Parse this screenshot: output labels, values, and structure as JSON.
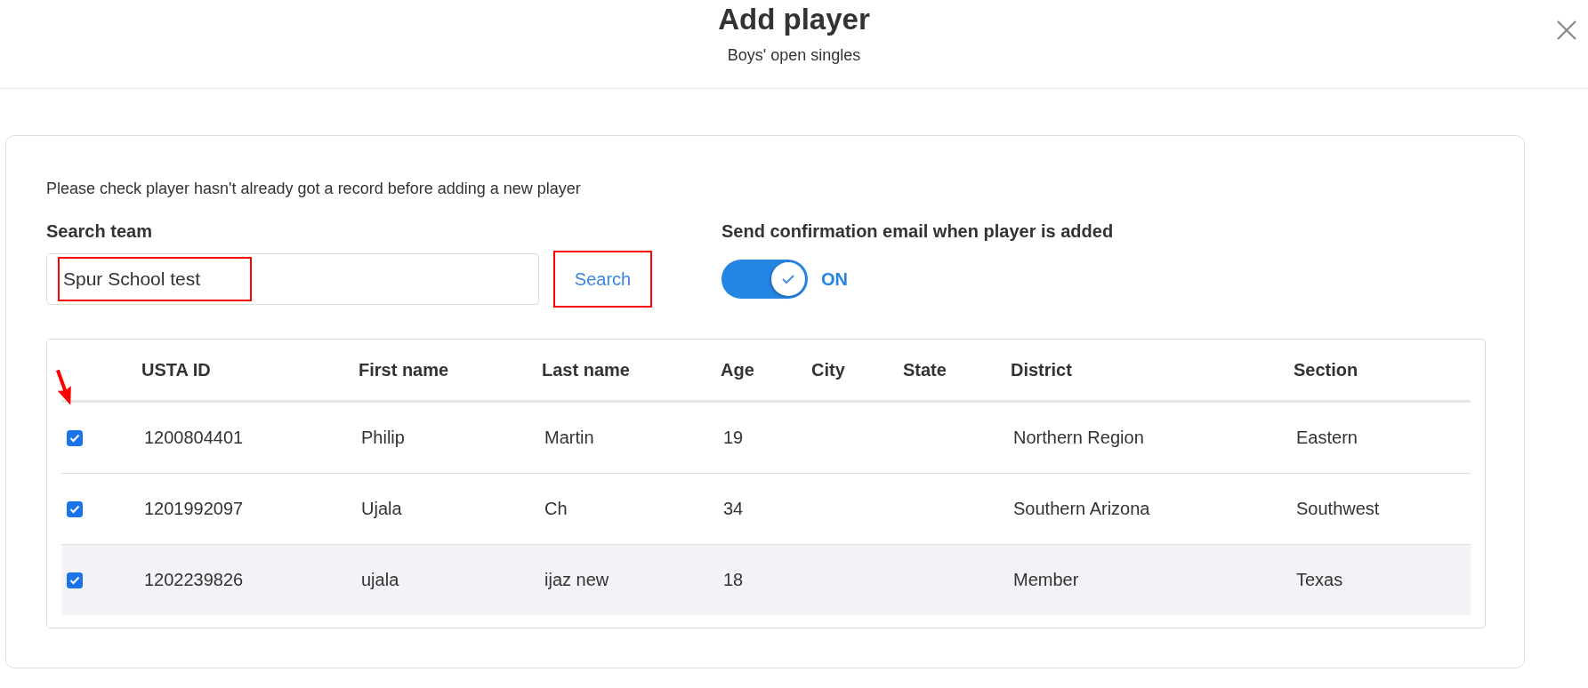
{
  "dialog": {
    "title": "Add player",
    "subtitle": "Boys' open singles"
  },
  "notice": "Please check player hasn't already got a record before adding a new player",
  "search": {
    "label": "Search team",
    "value": "Spur School test",
    "highlighted": true,
    "button": "Search",
    "button_highlighted": true
  },
  "email_toggle": {
    "label": "Send confirmation email when player is added",
    "on": true,
    "state_text": "ON"
  },
  "table": {
    "columns": [
      "USTA ID",
      "First name",
      "Last name",
      "Age",
      "City",
      "State",
      "District",
      "Section"
    ],
    "rows": [
      {
        "checked": true,
        "arrow_marker": true,
        "cells": [
          "1200804401",
          "Philip",
          "Martin",
          "19",
          "",
          "",
          "Northern Region",
          "Eastern"
        ]
      },
      {
        "checked": true,
        "cells": [
          "1201992097",
          "Ujala",
          "Ch",
          "34",
          "",
          "",
          "Southern Arizona",
          "Southwest"
        ]
      },
      {
        "checked": true,
        "hovered": true,
        "cells": [
          "1202239826",
          "ujala",
          "ijaz new",
          "18",
          "",
          "",
          "Member",
          "Texas"
        ]
      }
    ]
  }
}
